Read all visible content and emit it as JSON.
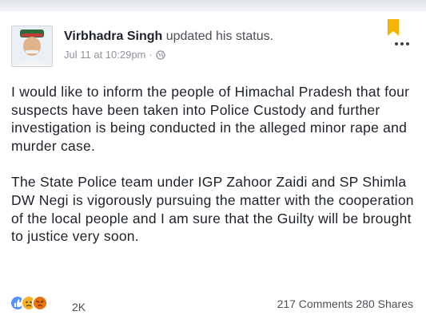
{
  "post": {
    "author": "Virbhadra Singh",
    "action": " updated his status.",
    "timestamp": "Jul 11 at 10:29pm",
    "separator": "·",
    "privacy_icon": "globe-icon",
    "paragraphs": [
      "I would like to inform the people of Himachal Pradesh that four suspects have been taken into Police Custody and further investigation is being conducted in the alleged minor rape and murder case.",
      "The State Police team under IGP Zahoor Zaidi and SP Shimla DW Negi is vigorously pursuing the matter with the cooperation of the local people and I am sure that the Guilty will be brought to justice very soon."
    ]
  },
  "header_icons": {
    "bookmark": "bookmark-icon",
    "more": "more-options-icon"
  },
  "footer": {
    "reaction_icons": [
      "like-icon",
      "sad-icon",
      "angry-icon"
    ],
    "reaction_count": "2K",
    "comments": "217 Comments",
    "shares": "280 Shares"
  },
  "colors": {
    "bookmark": "#f4b400",
    "like": "#5890ff",
    "text": "#1d2129",
    "meta": "#90949c"
  }
}
